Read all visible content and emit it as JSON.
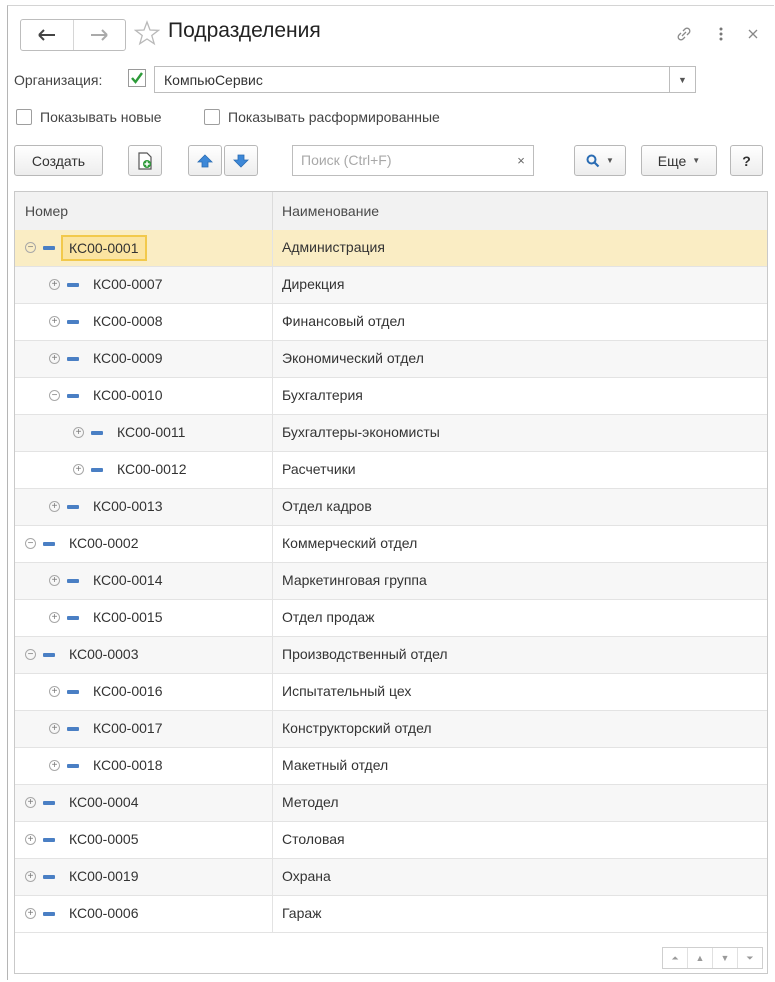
{
  "window": {
    "title": "Подразделения"
  },
  "org": {
    "label": "Организация:",
    "value": "КомпьюСервис",
    "checked": true
  },
  "filters": {
    "show_new": "Показывать новые",
    "show_disbanded": "Показывать расформированные"
  },
  "toolbar": {
    "create_label": "Создать",
    "search_placeholder": "Поиск (Ctrl+F)",
    "search_clear": "×",
    "more_label": "Еще",
    "help_label": "?"
  },
  "colors": {
    "accent_blue": "#4a7fc4",
    "selection": "#faedc4",
    "focus_border": "#f2c94c",
    "check_green": "#2e9b3a"
  },
  "table": {
    "columns": [
      "Номер",
      "Наименование"
    ],
    "rows": [
      {
        "code": "КС00-0001",
        "name": "Администрация",
        "level": 0,
        "expanded": true
      },
      {
        "code": "КС00-0007",
        "name": "Дирекция",
        "level": 1,
        "expanded": false
      },
      {
        "code": "КС00-0008",
        "name": "Финансовый отдел",
        "level": 1,
        "expanded": false
      },
      {
        "code": "КС00-0009",
        "name": "Экономический отдел",
        "level": 1,
        "expanded": false
      },
      {
        "code": "КС00-0010",
        "name": "Бухгалтерия",
        "level": 1,
        "expanded": true
      },
      {
        "code": "КС00-0011",
        "name": "Бухгалтеры-экономисты",
        "level": 2,
        "expanded": false
      },
      {
        "code": "КС00-0012",
        "name": "Расчетчики",
        "level": 2,
        "expanded": false
      },
      {
        "code": "КС00-0013",
        "name": "Отдел кадров",
        "level": 1,
        "expanded": false
      },
      {
        "code": "КС00-0002",
        "name": "Коммерческий отдел",
        "level": 0,
        "expanded": true
      },
      {
        "code": "КС00-0014",
        "name": "Маркетинговая группа",
        "level": 1,
        "expanded": false
      },
      {
        "code": "КС00-0015",
        "name": "Отдел продаж",
        "level": 1,
        "expanded": false
      },
      {
        "code": "КС00-0003",
        "name": "Производственный отдел",
        "level": 0,
        "expanded": true
      },
      {
        "code": "КС00-0016",
        "name": "Испытательный цех",
        "level": 1,
        "expanded": false
      },
      {
        "code": "КС00-0017",
        "name": "Конструкторский отдел",
        "level": 1,
        "expanded": false
      },
      {
        "code": "КС00-0018",
        "name": "Макетный отдел",
        "level": 1,
        "expanded": false
      },
      {
        "code": "КС00-0004",
        "name": "Методел",
        "level": 0,
        "expanded": false
      },
      {
        "code": "КС00-0005",
        "name": "Столовая",
        "level": 0,
        "expanded": false
      },
      {
        "code": "КС00-0019",
        "name": "Охрана",
        "level": 0,
        "expanded": false
      },
      {
        "code": "КС00-0006",
        "name": "Гараж",
        "level": 0,
        "expanded": false
      }
    ]
  }
}
